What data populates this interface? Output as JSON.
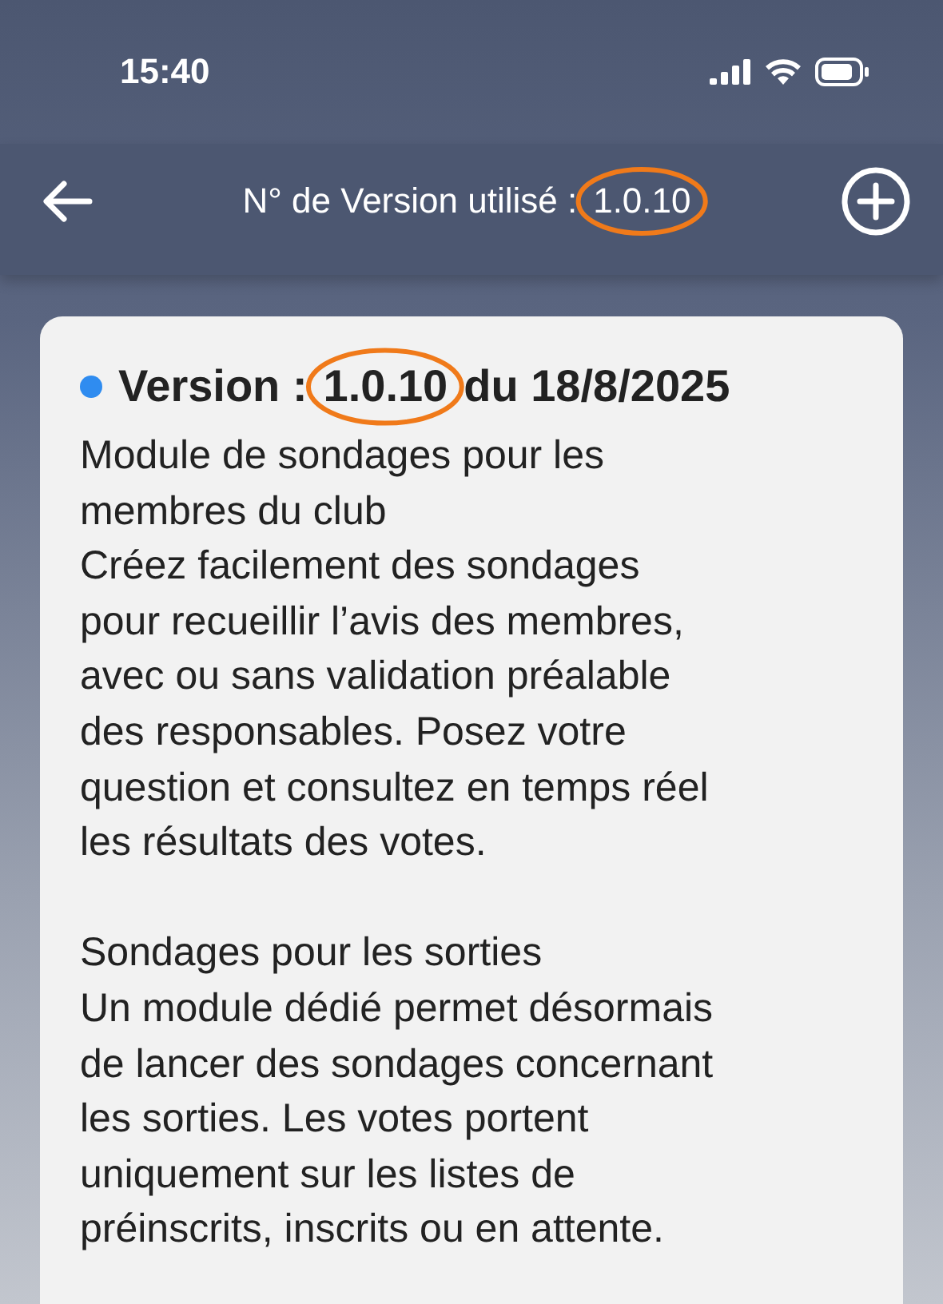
{
  "status_bar": {
    "time": "15:40"
  },
  "header": {
    "label": "N° de Version utilisé :",
    "version": "1.0.10",
    "version_circled": true
  },
  "card": {
    "title_prefix": "Version :",
    "version": "1.0.10",
    "version_circled": true,
    "date": "du 18/8/2025",
    "sections": [
      [
        "Module de sondages pour les",
        "membres du club",
        "Créez facilement des sondages",
        "pour recueillir l’avis des membres,",
        "avec ou sans validation préalable",
        "des responsables. Posez votre",
        "question et consultez en temps réel",
        "les résultats des votes."
      ],
      [
        "Sondages pour les sorties",
        "Un module dédié permet désormais",
        "de lancer des sondages concernant",
        "les sorties. Les votes portent",
        "uniquement sur les listes de",
        "préinscrits, inscrits ou en attente."
      ]
    ]
  }
}
